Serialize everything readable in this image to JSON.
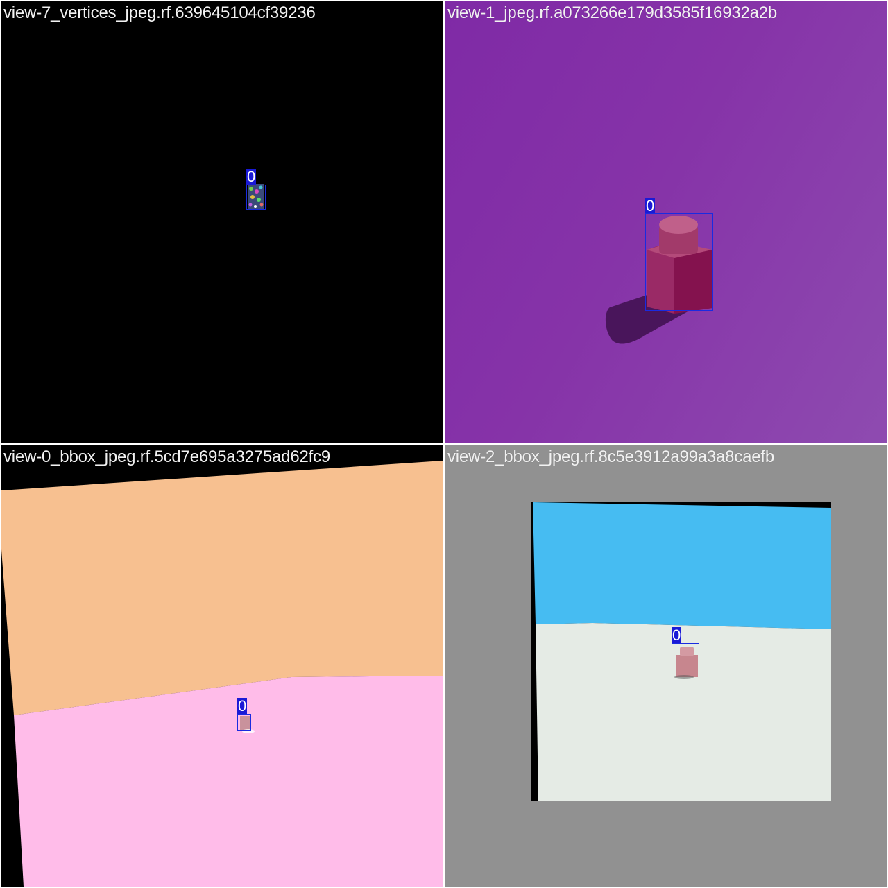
{
  "tiles": [
    {
      "caption": "view-7_vertices_jpeg.rf.639645104cf39236",
      "label": "0"
    },
    {
      "caption": "view-1_jpeg.rf.a073266e179d3585f16932a2b",
      "label": "0"
    },
    {
      "caption": "view-0_bbox_jpeg.rf.5cd7e695a3275ad62fc9",
      "label": "0"
    },
    {
      "caption": "view-2_bbox_jpeg.rf.8c5e3912a99a3a8caefb",
      "label": "0"
    }
  ],
  "colors": {
    "bbox": "#1a2be0",
    "label_bg": "#1a1ad6",
    "purple_bg": "#8233a8",
    "peach": "#f7c090",
    "pink_floor": "#ffbce9",
    "sky_blue": "#46bcf2",
    "pale_floor": "#e5ebe5",
    "gray_bg": "#919191"
  }
}
